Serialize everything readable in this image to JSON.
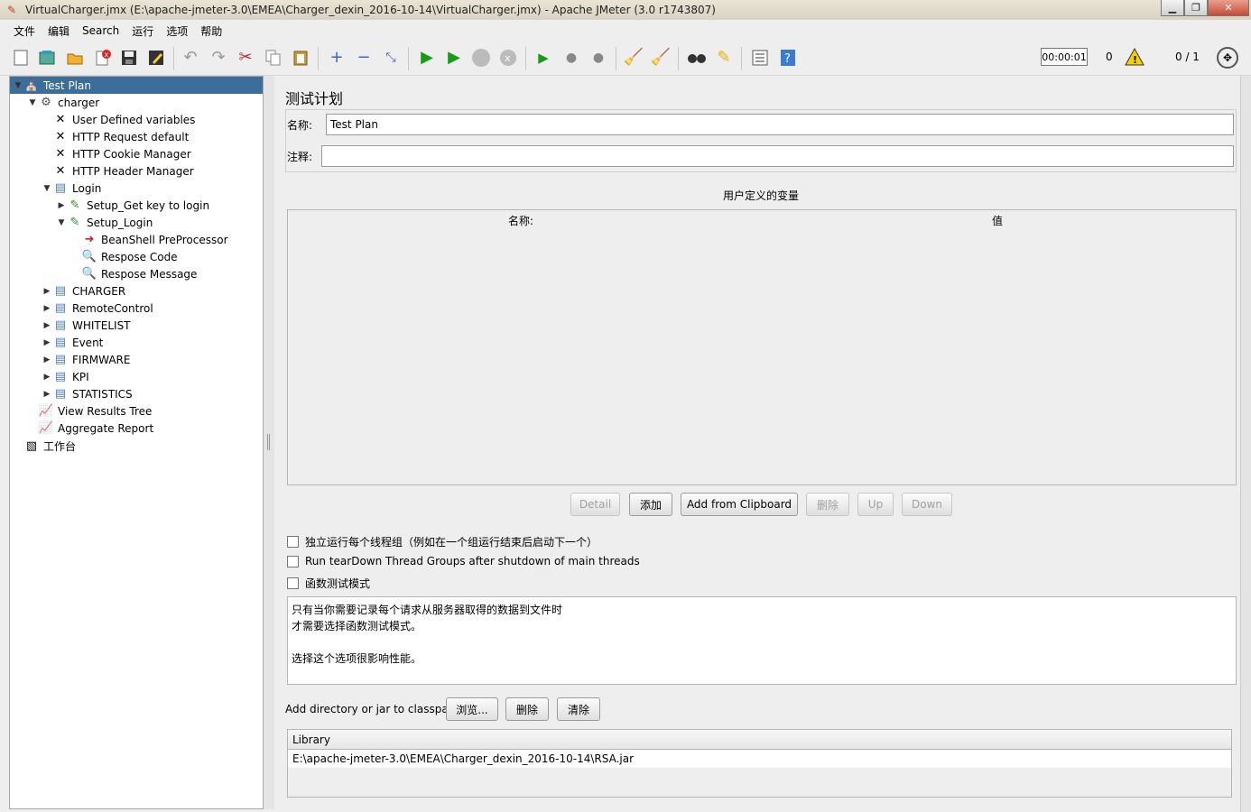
{
  "window": {
    "title": "VirtualCharger.jmx (E:\\apache-jmeter-3.0\\EMEA\\Charger_dexin_2016-10-14\\VirtualCharger.jmx) - Apache JMeter (3.0 r1743807)",
    "controls": {
      "minimize": "▁",
      "maximize": "❐",
      "close": "✕"
    }
  },
  "menu": {
    "file": "文件",
    "edit": "编辑",
    "search": "Search",
    "run": "运行",
    "options": "选项",
    "help": "帮助"
  },
  "toolbar": {
    "icons": [
      "new-icon",
      "templates-icon",
      "open-icon",
      "close-icon",
      "save-icon",
      "save-as-icon",
      "undo-icon",
      "redo-icon",
      "cut-icon",
      "copy-icon",
      "paste-icon",
      "expand-icon",
      "collapse-icon",
      "toggle-icon",
      "start-icon",
      "start-no-pause-icon",
      "stop-icon",
      "shutdown-icon",
      "remote-start-icon",
      "remote-stop-icon",
      "remote-shutdown-icon",
      "clear-icon",
      "clear-all-icon",
      "search-icon",
      "reset-search-icon",
      "function-helper-icon",
      "help-icon"
    ],
    "timer": "00:00:01",
    "error_count": "0",
    "threads": "0 / 1"
  },
  "tree": {
    "nodes": [
      {
        "label": "Test Plan",
        "icon": "test-plan-icon",
        "toggle": "▼",
        "selected": true
      },
      {
        "label": "charger",
        "icon": "thread-group-icon",
        "toggle": "▼"
      },
      {
        "label": "User Defined variables",
        "icon": "config-element-icon",
        "toggle": ""
      },
      {
        "label": "HTTP Request  default",
        "icon": "config-element-icon",
        "toggle": ""
      },
      {
        "label": "HTTP Cookie Manager",
        "icon": "config-element-icon",
        "toggle": ""
      },
      {
        "label": "HTTP Header Manager",
        "icon": "config-element-icon",
        "toggle": ""
      },
      {
        "label": "Login",
        "icon": "controller-icon",
        "toggle": "▼"
      },
      {
        "label": "Setup_Get key to login",
        "icon": "sampler-icon",
        "toggle": "▶"
      },
      {
        "label": "Setup_Login",
        "icon": "sampler-icon",
        "toggle": "▼"
      },
      {
        "label": "BeanShell PreProcessor",
        "icon": "preprocessor-icon",
        "toggle": ""
      },
      {
        "label": "Respose Code",
        "icon": "assertion-icon",
        "toggle": ""
      },
      {
        "label": "Respose Message",
        "icon": "assertion-icon",
        "toggle": ""
      },
      {
        "label": "CHARGER",
        "icon": "controller-icon",
        "toggle": "▶"
      },
      {
        "label": "RemoteControl",
        "icon": "controller-icon",
        "toggle": "▶"
      },
      {
        "label": "WHITELIST",
        "icon": "controller-icon",
        "toggle": "▶"
      },
      {
        "label": "Event",
        "icon": "controller-icon",
        "toggle": "▶"
      },
      {
        "label": "FIRMWARE",
        "icon": "controller-icon",
        "toggle": "▶"
      },
      {
        "label": "KPI",
        "icon": "controller-icon",
        "toggle": "▶"
      },
      {
        "label": "STATISTICS",
        "icon": "controller-icon",
        "toggle": "▶"
      },
      {
        "label": "View Results Tree",
        "icon": "listener-icon",
        "toggle": ""
      },
      {
        "label": "Aggregate Report",
        "icon": "listener-icon",
        "toggle": ""
      },
      {
        "label": "工作台",
        "icon": "workbench-icon",
        "toggle": ""
      }
    ]
  },
  "panel": {
    "title": "测试计划",
    "name_label": "名称:",
    "name_value": "Test Plan",
    "comment_label": "注释:",
    "comment_value": "",
    "udv_title": "用户定义的变量",
    "udv_col_name": "名称:",
    "udv_col_value": "值",
    "buttons": {
      "detail": "Detail",
      "add": "添加",
      "add_clipboard": "Add from Clipboard",
      "delete": "删除",
      "up": "Up",
      "down": "Down"
    },
    "checkboxes": {
      "serialize": "独立运行每个线程组（例如在一个组运行结束后启动下一个）",
      "teardown": "Run tearDown Thread Groups after shutdown of main threads",
      "functional": "函数测试模式"
    },
    "description": {
      "line1": "只有当你需要记录每个请求从服务器取得的数据到文件时",
      "line2": "才需要选择函数测试模式。",
      "line3": "选择这个选项很影响性能。"
    },
    "classpath_label": "Add directory or jar to classpath",
    "classpath_buttons": {
      "browse": "浏览...",
      "delete": "删除",
      "clear": "清除"
    },
    "library_header": "Library",
    "library_row": "E:\\apache-jmeter-3.0\\EMEA\\Charger_dexin_2016-10-14\\RSA.jar"
  }
}
